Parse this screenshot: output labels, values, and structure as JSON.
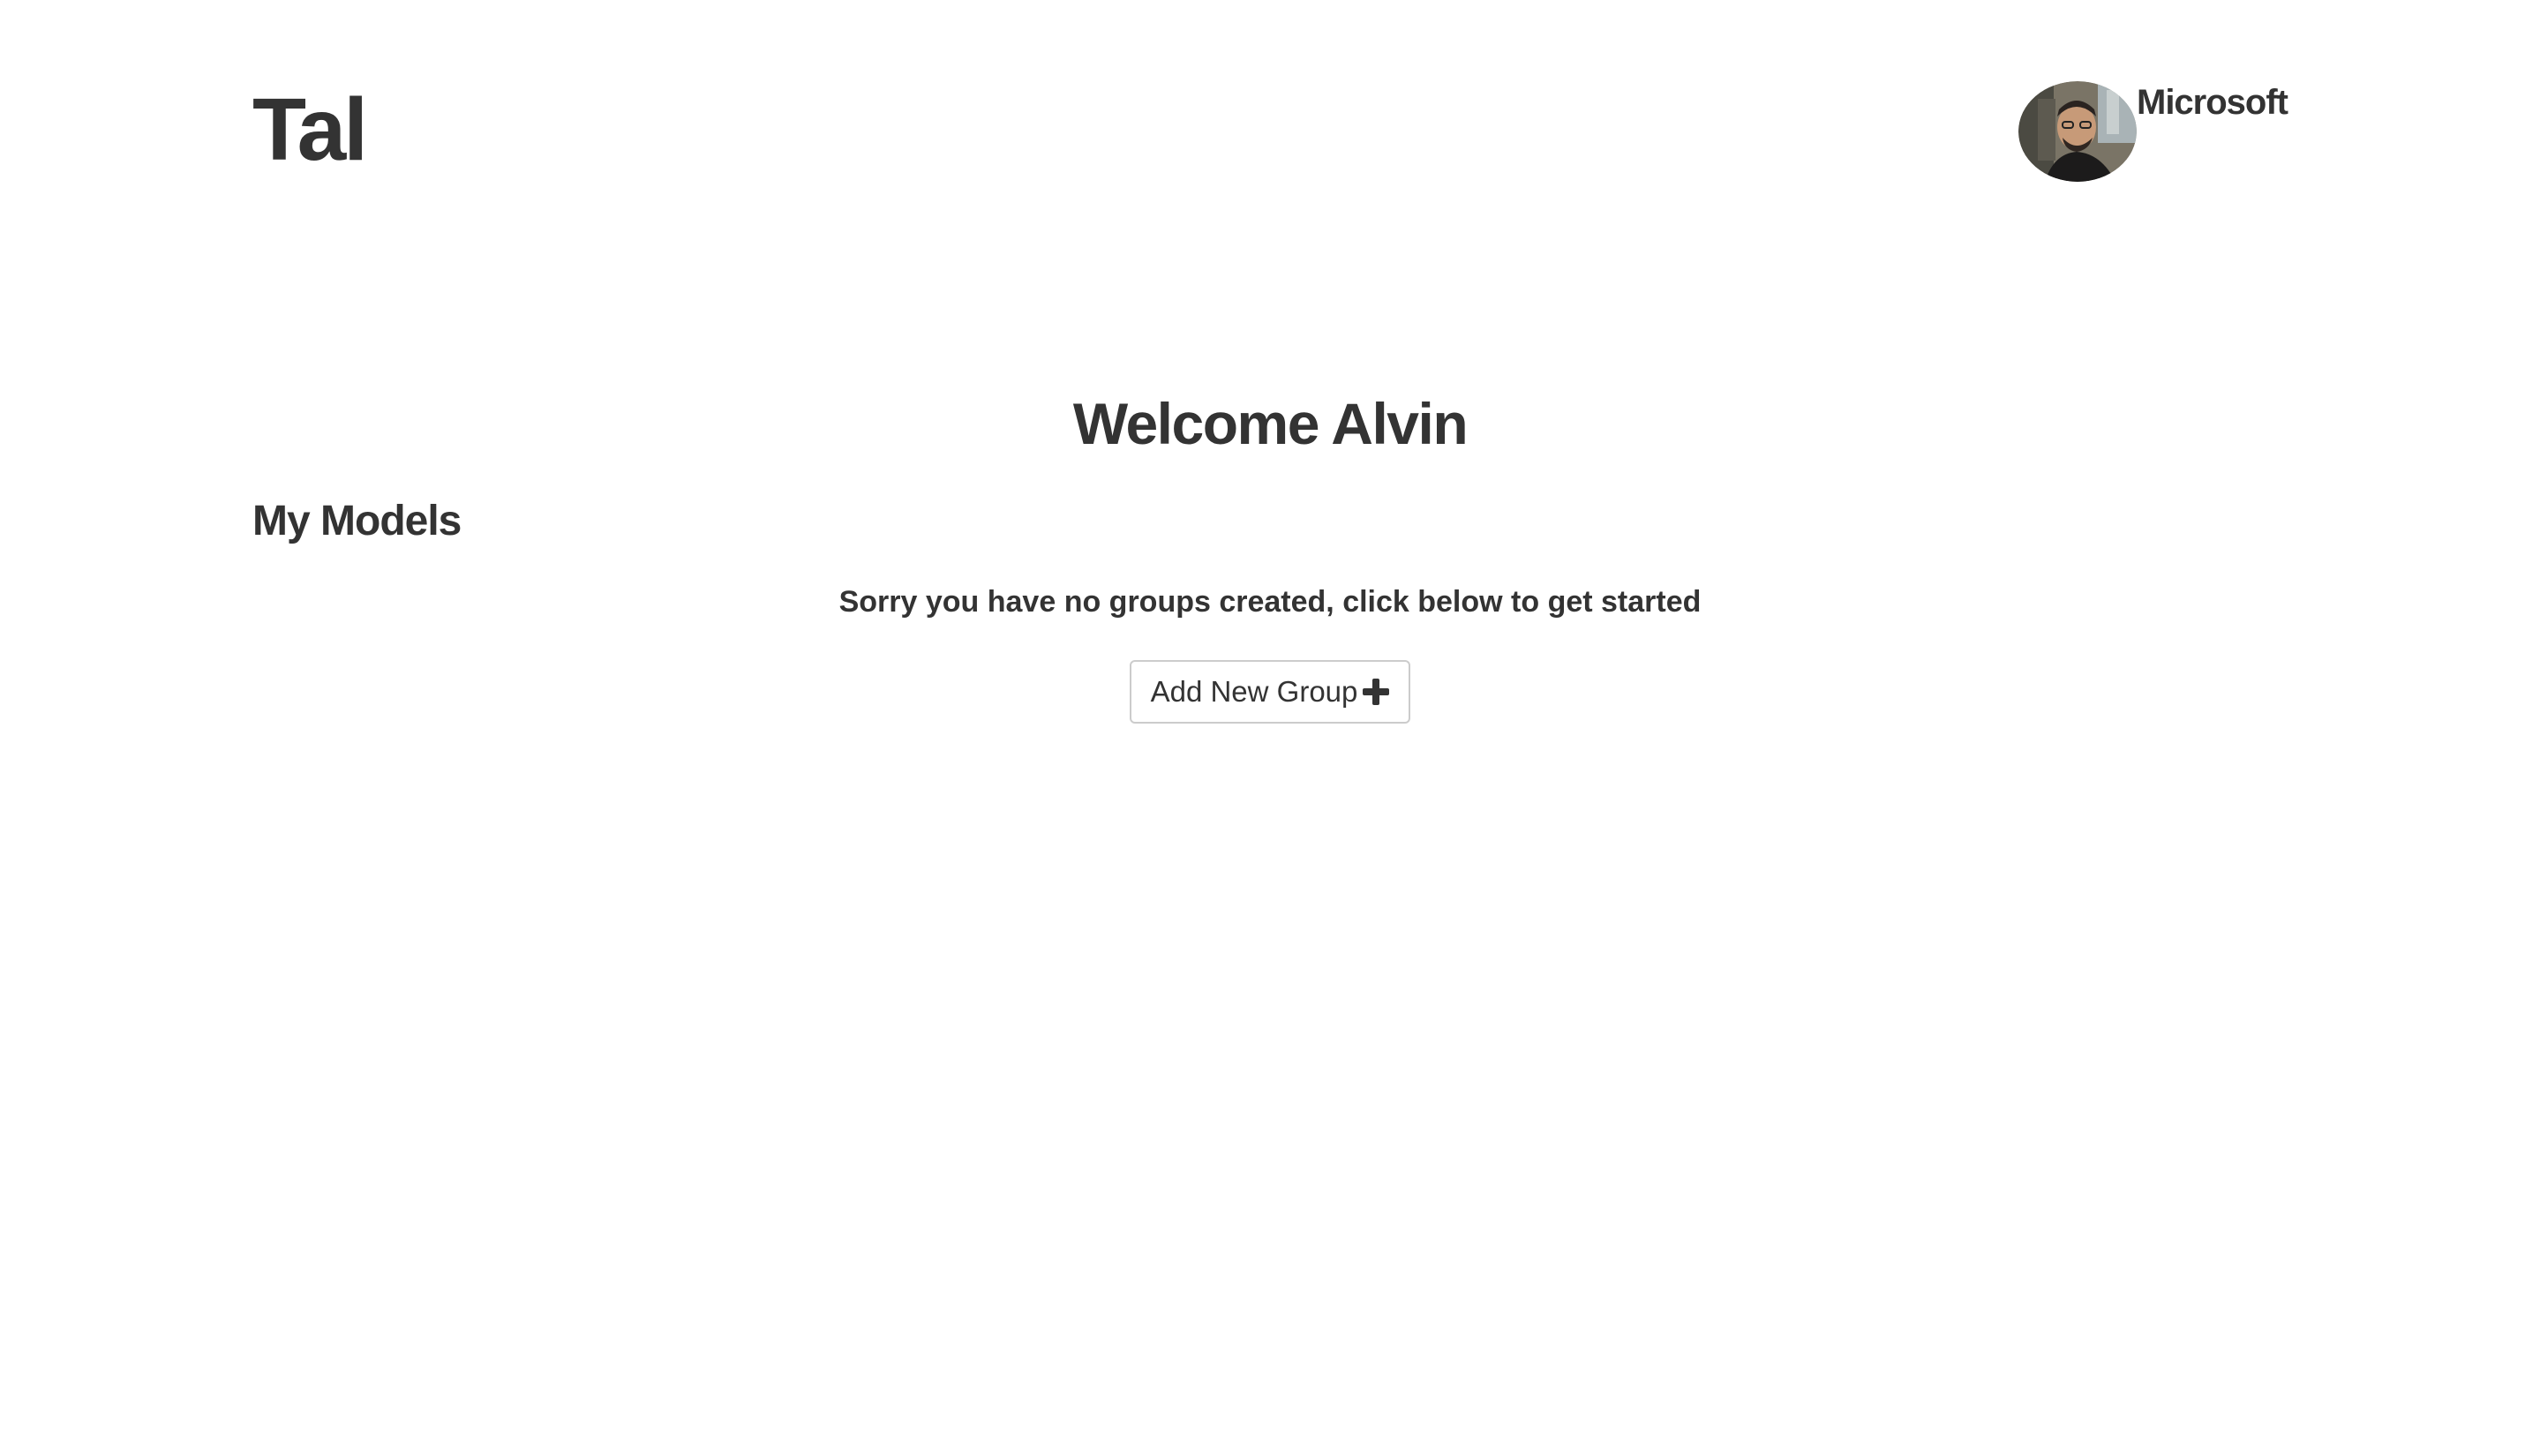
{
  "header": {
    "brand": "Tal",
    "account": {
      "org_name": "Microsoft",
      "avatar_icon": "user-avatar-photo"
    }
  },
  "main": {
    "welcome": "Welcome Alvin",
    "section_title": "My Models",
    "empty_message": "Sorry you have no groups created, click below to get started",
    "add_group_button": {
      "label": "Add New Group",
      "icon": "plus-icon"
    }
  },
  "colors": {
    "text": "#333333",
    "background": "#ffffff",
    "button_border": "#cccccc"
  }
}
